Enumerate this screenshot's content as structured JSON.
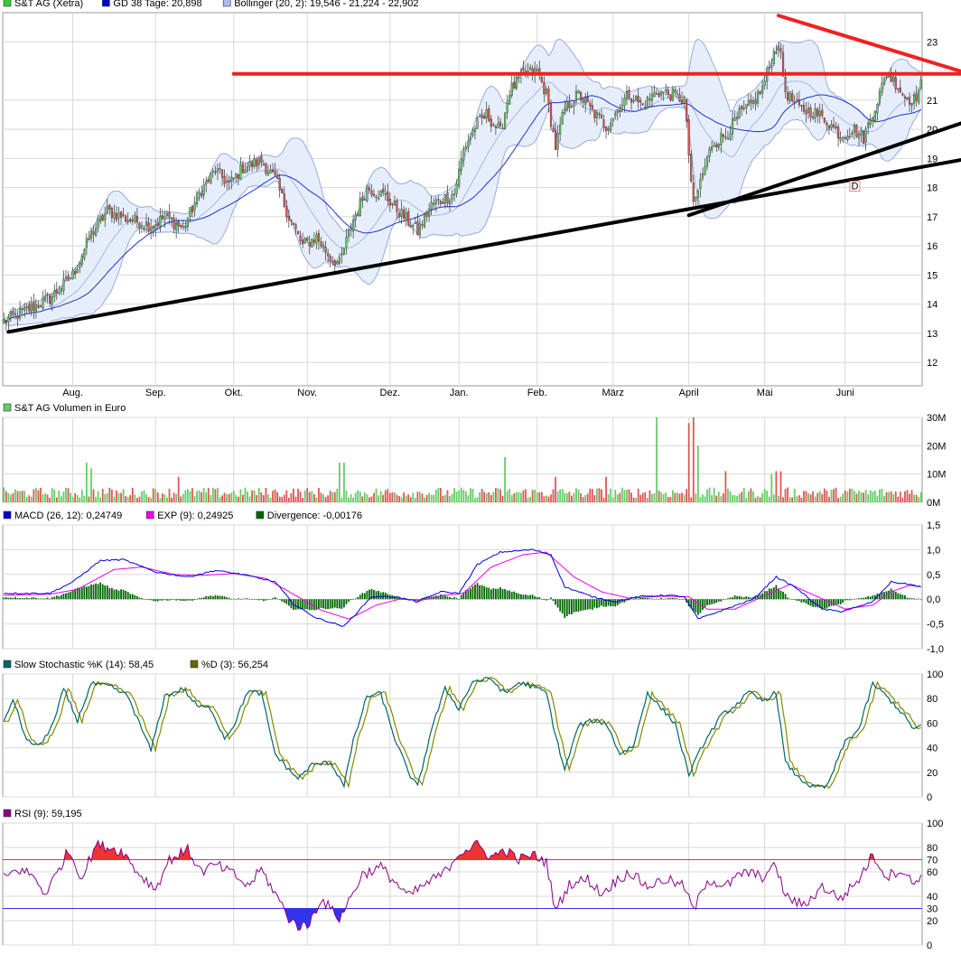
{
  "colors": {
    "up": "#66cc66",
    "down": "#e05555",
    "ma": "#2233cc",
    "band_fill": "#e6eefc",
    "band_line": "#99aadd",
    "grid": "#d8d8d8",
    "red_line": "#ee2222",
    "black_line": "#000000",
    "macd": "#0000dd",
    "exp": "#ee00ee",
    "divergence": "#006600",
    "stoch_k": "#006666",
    "stoch_d": "#888800",
    "rsi": "#880088",
    "rsi_over": "#ee3333",
    "rsi_under": "#3333ee"
  },
  "chart_data": [
    {
      "type": "candlestick",
      "legend": [
        {
          "label": "S&T AG (Xetra)",
          "color": "#33cc33"
        },
        {
          "label": "GD 38 Tage: 20,898",
          "color": "#0000cc"
        },
        {
          "label": "Bollinger (20, 2): 19,546 - 21,224 - 22,902",
          "color": "#aabbee"
        }
      ],
      "ylim": [
        11.2,
        24
      ],
      "y_ticks": [
        "12",
        "13",
        "14",
        "15",
        "16",
        "17",
        "18",
        "19",
        "20",
        "21",
        "23"
      ],
      "y_tick_values": [
        12,
        13,
        14,
        15,
        16,
        17,
        18,
        19,
        20,
        21,
        23
      ],
      "x_ticks": [
        "Aug.",
        "Sep.",
        "Okt.",
        "Nov.",
        "Dez.",
        "Jan.",
        "Feb.",
        "März",
        "April",
        "Mai",
        "Juni"
      ],
      "x_tick_index": [
        30,
        66,
        100,
        132,
        168,
        198,
        232,
        265,
        298,
        331,
        366
      ],
      "n_days": 400,
      "close_keys": [
        [
          0,
          13.4
        ],
        [
          10,
          13.8
        ],
        [
          20,
          14.2
        ],
        [
          30,
          15.0
        ],
        [
          38,
          16.4
        ],
        [
          45,
          17.2
        ],
        [
          55,
          16.9
        ],
        [
          65,
          16.7
        ],
        [
          70,
          17.0
        ],
        [
          78,
          16.6
        ],
        [
          85,
          17.8
        ],
        [
          92,
          18.6
        ],
        [
          98,
          18.1
        ],
        [
          104,
          18.7
        ],
        [
          112,
          18.9
        ],
        [
          118,
          18.3
        ],
        [
          124,
          17.0
        ],
        [
          130,
          16.0
        ],
        [
          136,
          16.3
        ],
        [
          142,
          15.6
        ],
        [
          146,
          15.4
        ],
        [
          152,
          16.9
        ],
        [
          158,
          18.0
        ],
        [
          166,
          17.7
        ],
        [
          174,
          17.0
        ],
        [
          180,
          16.5
        ],
        [
          186,
          17.4
        ],
        [
          196,
          17.8
        ],
        [
          200,
          19.3
        ],
        [
          205,
          20.1
        ],
        [
          210,
          20.5
        ],
        [
          216,
          19.9
        ],
        [
          220,
          21.3
        ],
        [
          226,
          21.9
        ],
        [
          232,
          22.0
        ],
        [
          236,
          21.2
        ],
        [
          240,
          19.4
        ],
        [
          244,
          20.7
        ],
        [
          250,
          21.2
        ],
        [
          256,
          20.6
        ],
        [
          262,
          20.1
        ],
        [
          268,
          20.8
        ],
        [
          272,
          21.2
        ],
        [
          278,
          20.8
        ],
        [
          284,
          21.3
        ],
        [
          290,
          21.2
        ],
        [
          296,
          21.0
        ],
        [
          300,
          17.3
        ],
        [
          303,
          18.2
        ],
        [
          308,
          19.5
        ],
        [
          314,
          19.8
        ],
        [
          320,
          20.5
        ],
        [
          326,
          20.9
        ],
        [
          330,
          21.4
        ],
        [
          334,
          22.4
        ],
        [
          337,
          23.0
        ],
        [
          340,
          21.3
        ],
        [
          346,
          20.7
        ],
        [
          352,
          20.6
        ],
        [
          358,
          20.3
        ],
        [
          364,
          19.8
        ],
        [
          370,
          20.0
        ],
        [
          374,
          19.7
        ],
        [
          380,
          21.0
        ],
        [
          384,
          21.9
        ],
        [
          388,
          21.6
        ],
        [
          392,
          21.1
        ],
        [
          396,
          21.0
        ],
        [
          399,
          21.5
        ]
      ],
      "ma38_last": 20.898,
      "bollinger_last": [
        19.546,
        21.224,
        22.902
      ],
      "trendlines": [
        {
          "color": "red",
          "from": [
            100,
            21.9
          ],
          "to": [
            420,
            21.9
          ]
        },
        {
          "color": "red",
          "from": [
            337,
            23.9
          ],
          "to": [
            420,
            21.9
          ]
        },
        {
          "color": "black",
          "from": [
            2,
            13.05
          ],
          "to": [
            420,
            19.0
          ]
        },
        {
          "color": "black",
          "from": [
            298,
            17.05
          ],
          "to": [
            420,
            20.3
          ]
        }
      ],
      "marker_label": "D",
      "marker_at": [
        370,
        18.0
      ]
    },
    {
      "type": "bar",
      "legend": [
        {
          "label": "S&T AG Volumen in Euro",
          "color": "#66cc66"
        }
      ],
      "ylim": [
        0,
        30
      ],
      "y_ticks": [
        "0M",
        "10M",
        "20M",
        "30M"
      ],
      "y_tick_values": [
        0,
        10,
        20,
        30
      ],
      "spikes": [
        [
          36,
          14
        ],
        [
          38,
          12
        ],
        [
          76,
          9
        ],
        [
          146,
          14
        ],
        [
          148,
          14
        ],
        [
          218,
          16
        ],
        [
          240,
          9
        ],
        [
          262,
          9
        ],
        [
          284,
          30
        ],
        [
          298,
          28
        ],
        [
          300,
          30
        ],
        [
          302,
          20
        ],
        [
          314,
          11
        ],
        [
          334,
          10
        ],
        [
          336,
          11
        ],
        [
          338,
          11
        ]
      ]
    },
    {
      "type": "line",
      "legend": [
        {
          "label": "MACD (26, 12): 0,24749",
          "color": "#0000cc"
        },
        {
          "label": "EXP (9): 0,24925",
          "color": "#ee00ee"
        },
        {
          "label": "Divergence: -0,00176",
          "color": "#006600"
        }
      ],
      "ylim": [
        -1.0,
        1.5
      ],
      "y_ticks": [
        "-1,0",
        "-0,5",
        "0,0",
        "0,5",
        "1,0",
        "1,5"
      ],
      "y_tick_values": [
        -1.0,
        -0.5,
        0,
        0.5,
        1.0,
        1.5
      ],
      "macd_keys": [
        [
          0,
          0.12
        ],
        [
          20,
          0.12
        ],
        [
          30,
          0.35
        ],
        [
          42,
          0.78
        ],
        [
          52,
          0.8
        ],
        [
          66,
          0.55
        ],
        [
          80,
          0.45
        ],
        [
          92,
          0.58
        ],
        [
          104,
          0.5
        ],
        [
          118,
          0.35
        ],
        [
          126,
          -0.1
        ],
        [
          136,
          -0.38
        ],
        [
          148,
          -0.55
        ],
        [
          160,
          0.05
        ],
        [
          170,
          0.05
        ],
        [
          180,
          -0.05
        ],
        [
          190,
          0.15
        ],
        [
          198,
          0.12
        ],
        [
          206,
          0.7
        ],
        [
          216,
          0.95
        ],
        [
          230,
          1.0
        ],
        [
          238,
          0.9
        ],
        [
          244,
          0.25
        ],
        [
          256,
          0.05
        ],
        [
          266,
          -0.05
        ],
        [
          276,
          0.05
        ],
        [
          288,
          0.08
        ],
        [
          296,
          0.05
        ],
        [
          302,
          -0.4
        ],
        [
          314,
          -0.2
        ],
        [
          326,
          0.0
        ],
        [
          336,
          0.45
        ],
        [
          344,
          0.25
        ],
        [
          356,
          -0.2
        ],
        [
          364,
          -0.25
        ],
        [
          372,
          -0.15
        ],
        [
          378,
          -0.05
        ],
        [
          386,
          0.35
        ],
        [
          394,
          0.3
        ],
        [
          399,
          0.25
        ]
      ],
      "exp_keys": [
        [
          0,
          0.08
        ],
        [
          20,
          0.1
        ],
        [
          32,
          0.2
        ],
        [
          48,
          0.6
        ],
        [
          60,
          0.65
        ],
        [
          74,
          0.5
        ],
        [
          86,
          0.48
        ],
        [
          100,
          0.52
        ],
        [
          114,
          0.42
        ],
        [
          126,
          0.1
        ],
        [
          138,
          -0.22
        ],
        [
          150,
          -0.4
        ],
        [
          162,
          -0.12
        ],
        [
          172,
          0.0
        ],
        [
          182,
          -0.02
        ],
        [
          192,
          0.08
        ],
        [
          200,
          0.12
        ],
        [
          212,
          0.65
        ],
        [
          226,
          0.9
        ],
        [
          236,
          0.95
        ],
        [
          248,
          0.45
        ],
        [
          260,
          0.15
        ],
        [
          272,
          0.02
        ],
        [
          286,
          0.06
        ],
        [
          298,
          0.05
        ],
        [
          306,
          -0.2
        ],
        [
          318,
          -0.2
        ],
        [
          330,
          0.05
        ],
        [
          342,
          0.3
        ],
        [
          354,
          0.05
        ],
        [
          366,
          -0.2
        ],
        [
          378,
          -0.12
        ],
        [
          386,
          0.15
        ],
        [
          394,
          0.28
        ],
        [
          399,
          0.25
        ]
      ]
    },
    {
      "type": "line",
      "legend": [
        {
          "label": "Slow Stochastic %K (14): 58,45",
          "color": "#006666"
        },
        {
          "label": "%D (3): 56,254",
          "color": "#666600"
        }
      ],
      "ylim": [
        0,
        100
      ],
      "y_ticks": [
        "0",
        "20",
        "40",
        "60",
        "80",
        "100"
      ],
      "y_tick_values": [
        0,
        20,
        40,
        60,
        80,
        100
      ],
      "k_keys": [
        [
          0,
          60
        ],
        [
          4,
          80
        ],
        [
          10,
          45
        ],
        [
          16,
          42
        ],
        [
          22,
          62
        ],
        [
          26,
          88
        ],
        [
          32,
          62
        ],
        [
          38,
          92
        ],
        [
          46,
          90
        ],
        [
          54,
          82
        ],
        [
          60,
          55
        ],
        [
          64,
          38
        ],
        [
          70,
          82
        ],
        [
          78,
          88
        ],
        [
          84,
          74
        ],
        [
          90,
          72
        ],
        [
          96,
          48
        ],
        [
          100,
          58
        ],
        [
          106,
          86
        ],
        [
          112,
          84
        ],
        [
          118,
          35
        ],
        [
          124,
          22
        ],
        [
          128,
          15
        ],
        [
          134,
          26
        ],
        [
          142,
          28
        ],
        [
          148,
          10
        ],
        [
          152,
          45
        ],
        [
          158,
          82
        ],
        [
          164,
          84
        ],
        [
          170,
          48
        ],
        [
          176,
          20
        ],
        [
          180,
          8
        ],
        [
          186,
          55
        ],
        [
          192,
          88
        ],
        [
          198,
          72
        ],
        [
          204,
          94
        ],
        [
          212,
          96
        ],
        [
          218,
          84
        ],
        [
          224,
          93
        ],
        [
          230,
          90
        ],
        [
          236,
          85
        ],
        [
          240,
          50
        ],
        [
          244,
          22
        ],
        [
          250,
          58
        ],
        [
          256,
          62
        ],
        [
          262,
          60
        ],
        [
          268,
          35
        ],
        [
          274,
          42
        ],
        [
          280,
          85
        ],
        [
          286,
          72
        ],
        [
          292,
          60
        ],
        [
          298,
          18
        ],
        [
          304,
          42
        ],
        [
          312,
          66
        ],
        [
          318,
          74
        ],
        [
          324,
          85
        ],
        [
          330,
          78
        ],
        [
          336,
          85
        ],
        [
          340,
          28
        ],
        [
          346,
          15
        ],
        [
          352,
          8
        ],
        [
          358,
          8
        ],
        [
          366,
          45
        ],
        [
          372,
          55
        ],
        [
          378,
          92
        ],
        [
          384,
          82
        ],
        [
          390,
          70
        ],
        [
          396,
          55
        ],
        [
          399,
          58
        ]
      ],
      "d_offset": 2
    },
    {
      "type": "line",
      "legend": [
        {
          "label": "RSI (9): 59,195",
          "color": "#880088"
        }
      ],
      "ylim": [
        0,
        100
      ],
      "y_ticks": [
        "0",
        "20",
        "40",
        "60",
        "80",
        "100"
      ],
      "y_tick_values": [
        0,
        20,
        40,
        60,
        80,
        100
      ],
      "ref_lines": [
        {
          "value": 70,
          "label": "70",
          "color": "#ee3333"
        },
        {
          "value": 30,
          "label": "30",
          "color": "#3333ee"
        }
      ],
      "rsi_keys": [
        [
          0,
          55
        ],
        [
          6,
          62
        ],
        [
          12,
          58
        ],
        [
          18,
          42
        ],
        [
          24,
          62
        ],
        [
          28,
          78
        ],
        [
          34,
          55
        ],
        [
          40,
          82
        ],
        [
          46,
          80
        ],
        [
          52,
          76
        ],
        [
          58,
          60
        ],
        [
          66,
          46
        ],
        [
          72,
          70
        ],
        [
          80,
          78
        ],
        [
          86,
          60
        ],
        [
          92,
          66
        ],
        [
          100,
          58
        ],
        [
          106,
          48
        ],
        [
          112,
          62
        ],
        [
          120,
          36
        ],
        [
          124,
          22
        ],
        [
          128,
          16
        ],
        [
          132,
          15
        ],
        [
          138,
          38
        ],
        [
          146,
          22
        ],
        [
          150,
          36
        ],
        [
          156,
          58
        ],
        [
          164,
          64
        ],
        [
          170,
          52
        ],
        [
          176,
          40
        ],
        [
          182,
          48
        ],
        [
          192,
          60
        ],
        [
          198,
          76
        ],
        [
          206,
          82
        ],
        [
          212,
          72
        ],
        [
          218,
          78
        ],
        [
          224,
          70
        ],
        [
          230,
          74
        ],
        [
          236,
          68
        ],
        [
          240,
          28
        ],
        [
          246,
          50
        ],
        [
          254,
          54
        ],
        [
          260,
          42
        ],
        [
          266,
          52
        ],
        [
          272,
          60
        ],
        [
          280,
          48
        ],
        [
          288,
          54
        ],
        [
          296,
          48
        ],
        [
          300,
          28
        ],
        [
          306,
          54
        ],
        [
          314,
          48
        ],
        [
          322,
          60
        ],
        [
          330,
          56
        ],
        [
          336,
          65
        ],
        [
          340,
          40
        ],
        [
          348,
          32
        ],
        [
          356,
          48
        ],
        [
          364,
          38
        ],
        [
          372,
          54
        ],
        [
          378,
          74
        ],
        [
          384,
          56
        ],
        [
          390,
          62
        ],
        [
          396,
          50
        ],
        [
          399,
          59
        ]
      ]
    }
  ]
}
